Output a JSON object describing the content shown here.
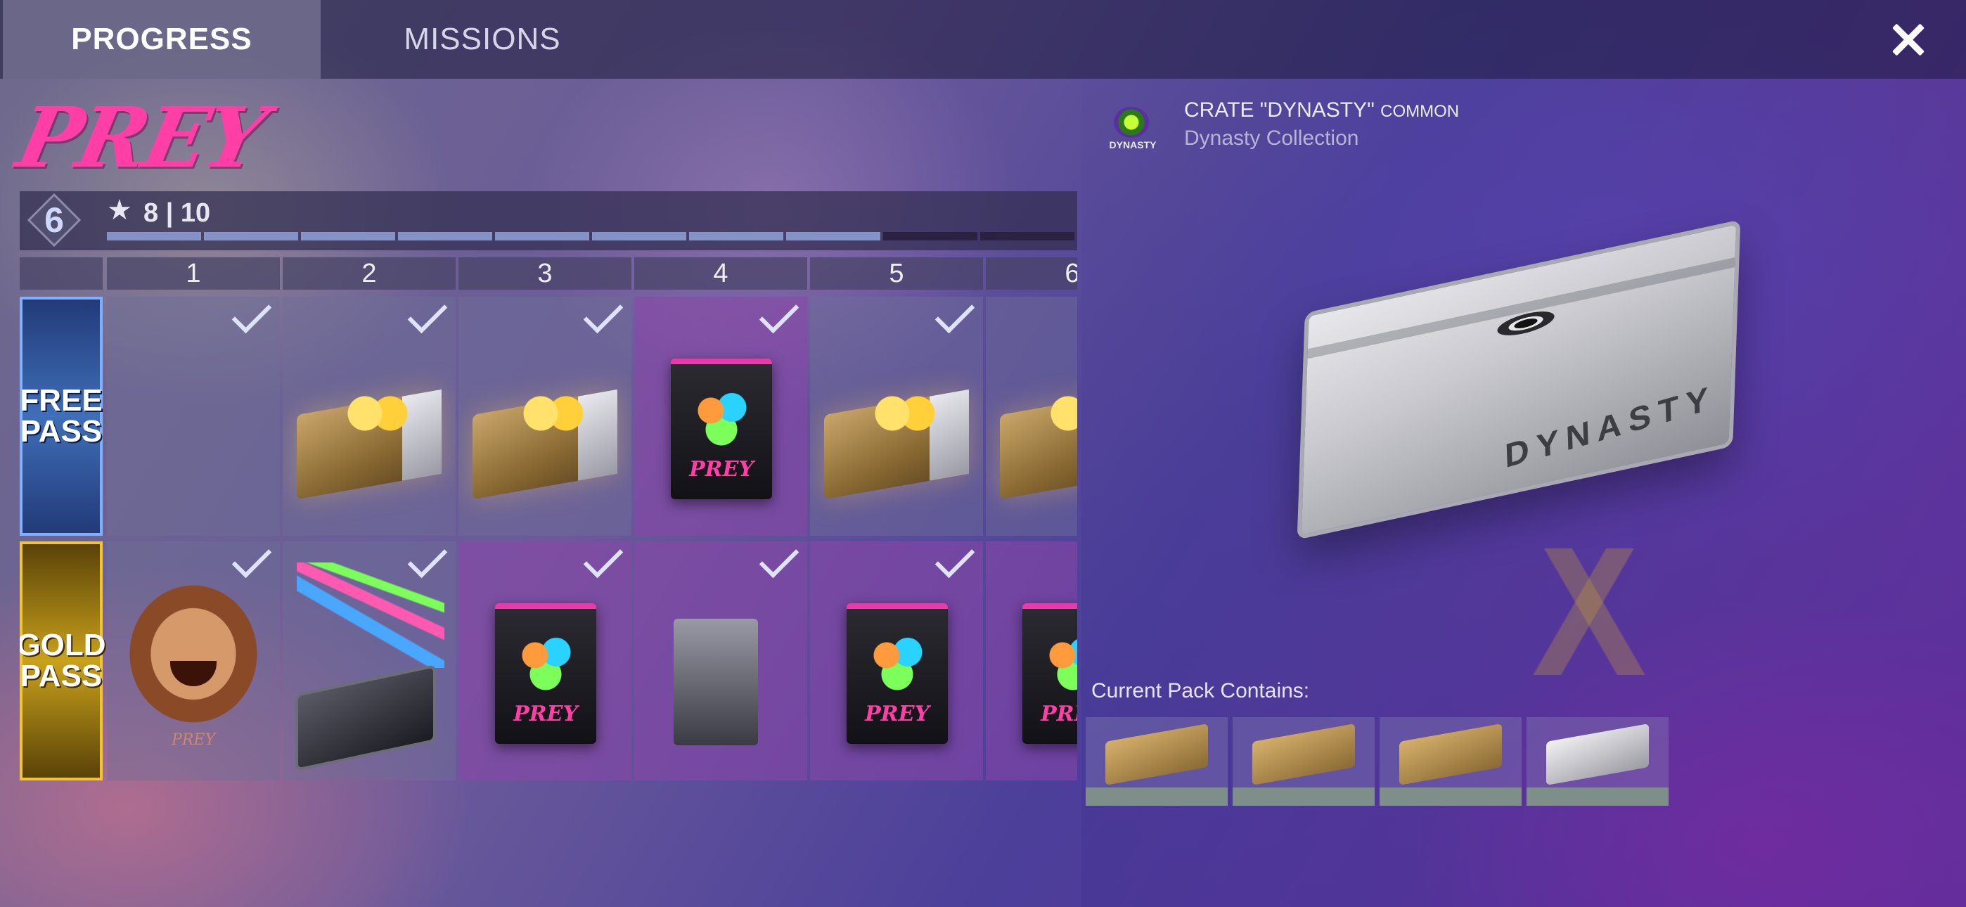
{
  "tabs": [
    {
      "label": "PROGRESS",
      "active": true
    },
    {
      "label": "MISSIONS",
      "active": false
    }
  ],
  "close_icon": "close-x-icon",
  "event": {
    "brand": "PREY",
    "level": "6",
    "stars": "8 | 10",
    "progress_segments_total": 10,
    "progress_segments_filled": 8
  },
  "grid": {
    "columns": [
      "1",
      "2",
      "3",
      "4",
      "5",
      "6"
    ],
    "free_pass_label": "FREE PASS",
    "gold_pass_label": "GOLD PASS",
    "pack_label": "PREY",
    "tiger_label": "PREY"
  },
  "crate": {
    "logo_text": "DYNASTY",
    "title": "CRATE \"DYNASTY\"",
    "rarity": "COMMON",
    "collection": "Dynasty Collection",
    "crate_text": "DYNASTY"
  },
  "pack": {
    "contains_label": "Current Pack Contains:",
    "items": [
      "wood-crate",
      "wood-crate",
      "wood-crate",
      "white-crate"
    ]
  },
  "colors": {
    "brand": "#ff3fa6",
    "free_pass": "#3e6fb8",
    "gold_pass": "#c9a21b",
    "progress_filled": "#8592c6"
  }
}
